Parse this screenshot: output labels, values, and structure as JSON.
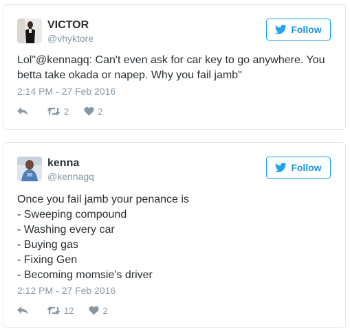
{
  "colors": {
    "accent": "#1da1f2",
    "text": "#292f33",
    "muted": "#8899a6",
    "border": "#e1e8ed"
  },
  "tweets": [
    {
      "name": "VICTOR",
      "handle": "@vhyktore",
      "follow_label": "Follow",
      "text_lines": [
        "Lol\"@kennagq: Can't even ask for car key to go anywhere. You",
        "betta take okada or napep. Why you fail jamb\""
      ],
      "timestamp": "2:14 PM - 27 Feb 2016",
      "retweets": "2",
      "likes": "2",
      "icons": {
        "reply": "reply-icon",
        "retweet": "retweet-icon",
        "like": "heart-icon",
        "follow": "twitter-bird-icon"
      }
    },
    {
      "name": "kenna",
      "handle": "@kennagq",
      "follow_label": "Follow",
      "text_lines": [
        "Once you fail jamb your penance is",
        "- Sweeping compound",
        "- Washing every car",
        "- Buying gas",
        "- Fixing Gen",
        "- Becoming momsie's driver"
      ],
      "timestamp": "2:12 PM - 27 Feb 2016",
      "retweets": "12",
      "likes": "2",
      "icons": {
        "reply": "reply-icon",
        "retweet": "retweet-icon",
        "like": "heart-icon",
        "follow": "twitter-bird-icon"
      }
    }
  ]
}
